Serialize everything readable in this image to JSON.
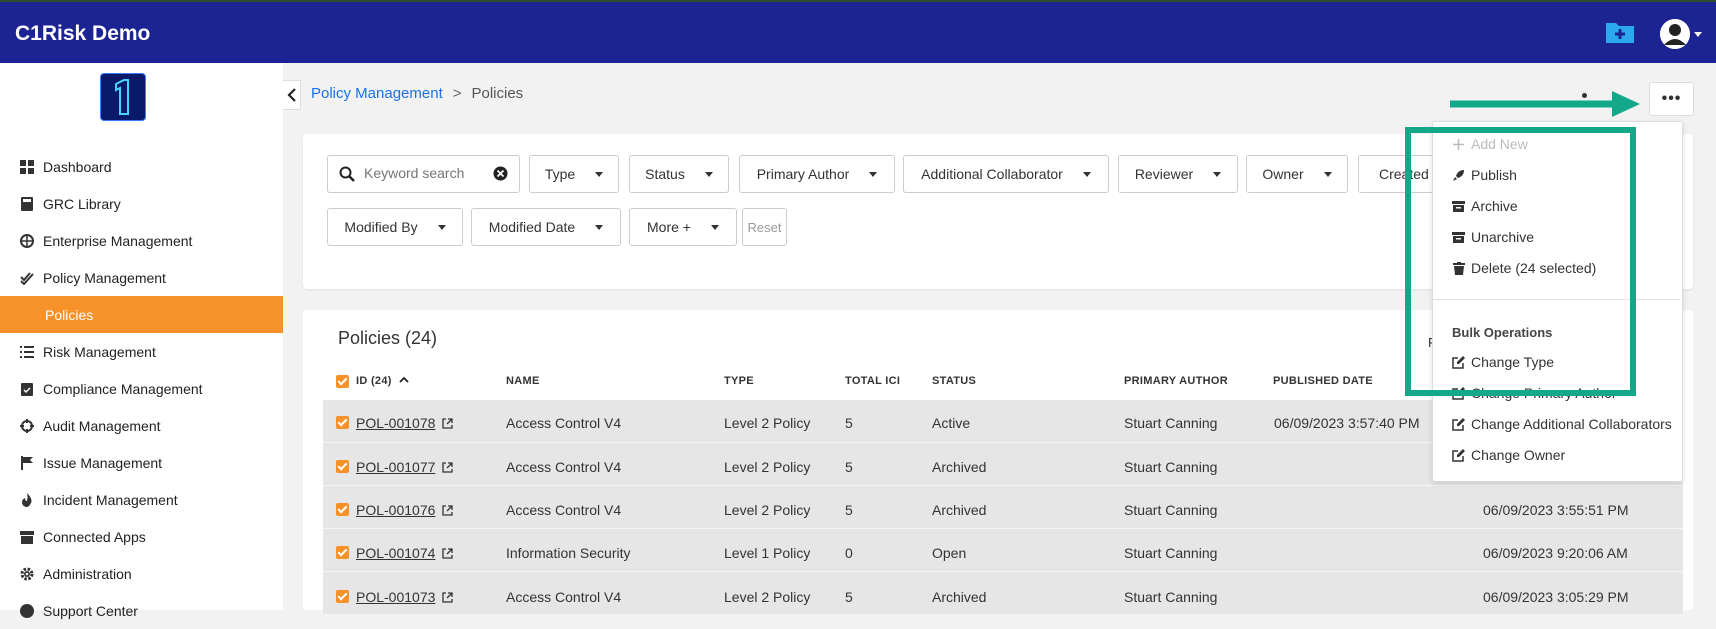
{
  "app": {
    "title": "C1Risk Demo"
  },
  "sidebar": {
    "items": [
      {
        "label": "Dashboard",
        "icon": "dashboard-icon"
      },
      {
        "label": "GRC Library",
        "icon": "book-icon"
      },
      {
        "label": "Enterprise Management",
        "icon": "globe-icon"
      },
      {
        "label": "Policy Management",
        "icon": "check-double-icon"
      },
      {
        "label": "Policies",
        "active": true
      },
      {
        "label": "Risk Management",
        "icon": "list-icon"
      },
      {
        "label": "Compliance Management",
        "icon": "clipboard-check-icon"
      },
      {
        "label": "Audit Management",
        "icon": "crosshair-icon"
      },
      {
        "label": "Issue Management",
        "icon": "flag-icon"
      },
      {
        "label": "Incident Management",
        "icon": "fire-icon"
      },
      {
        "label": "Connected Apps",
        "icon": "store-icon"
      },
      {
        "label": "Administration",
        "icon": "gear-icon"
      },
      {
        "label": "Support Center",
        "icon": "question-icon"
      }
    ]
  },
  "breadcrumb": {
    "parent": "Policy Management",
    "separator": ">",
    "current": "Policies"
  },
  "toolbar": {
    "more_label": "•••"
  },
  "filters": {
    "search_placeholder": "Keyword search",
    "buttons": [
      "Type",
      "Status",
      "Primary Author",
      "Additional Collaborator",
      "Reviewer",
      "Owner",
      "Created"
    ],
    "buttons_row2": [
      "Modified By",
      "Modified Date",
      "More +"
    ],
    "reset_label": "Reset"
  },
  "table": {
    "title": "Policies (24)",
    "partial_text": "P",
    "headers": {
      "id": "ID (24)",
      "name": "NAME",
      "type": "TYPE",
      "total_ici": "TOTAL ICI",
      "status": "STATUS",
      "primary_author": "PRIMARY AUTHOR",
      "published_date": "PUBLISHED DATE"
    },
    "rows": [
      {
        "id": "POL-001078",
        "name": "Access Control V4",
        "type": "Level 2 Policy",
        "total_ici": "5",
        "status": "Active",
        "primary_author": "Stuart Canning",
        "published_date": "06/09/2023 3:57:40 PM",
        "modified_date": ""
      },
      {
        "id": "POL-001077",
        "name": "Access Control V4",
        "type": "Level 2 Policy",
        "total_ici": "5",
        "status": "Archived",
        "primary_author": "Stuart Canning",
        "published_date": "",
        "modified_date": ""
      },
      {
        "id": "POL-001076",
        "name": "Access Control V4",
        "type": "Level 2 Policy",
        "total_ici": "5",
        "status": "Archived",
        "primary_author": "Stuart Canning",
        "published_date": "",
        "modified_date": "06/09/2023 3:55:51 PM"
      },
      {
        "id": "POL-001074",
        "name": "Information Security",
        "type": "Level 1 Policy",
        "total_ici": "0",
        "status": "Open",
        "primary_author": "Stuart Canning",
        "published_date": "",
        "modified_date": "06/09/2023 9:20:06 AM"
      },
      {
        "id": "POL-001073",
        "name": "Access Control V4",
        "type": "Level 2 Policy",
        "total_ici": "5",
        "status": "Archived",
        "primary_author": "Stuart Canning",
        "published_date": "",
        "modified_date": "06/09/2023 3:05:29 PM"
      }
    ]
  },
  "dropdown": {
    "add_new": "Add New",
    "publish": "Publish",
    "archive": "Archive",
    "unarchive": "Unarchive",
    "delete": "Delete (24 selected)",
    "bulk_heading": "Bulk Operations",
    "change_type": "Change Type",
    "change_primary_author": "Change Primary Author",
    "change_additional_collaborators": "Change Additional Collaborators",
    "change_owner": "Change Owner"
  },
  "colors": {
    "topbar": "#1c2493",
    "accent": "#f7922a",
    "highlight": "#14a88a",
    "link": "#1a73e8"
  }
}
